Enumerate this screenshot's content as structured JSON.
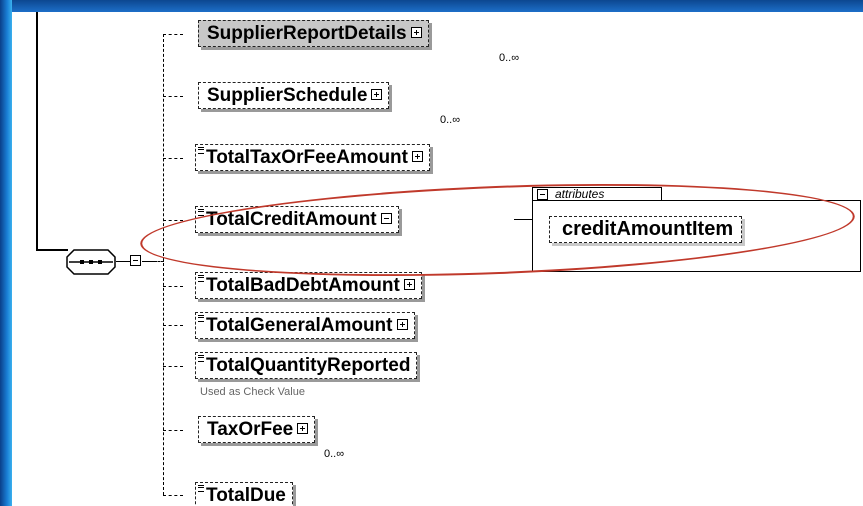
{
  "diagram": {
    "elements": [
      {
        "label": "SupplierReportDetails",
        "cardinality": "0..∞",
        "expander": "plus",
        "highlighted": true
      },
      {
        "label": "SupplierSchedule",
        "cardinality": "0..∞",
        "expander": "plus"
      },
      {
        "label": "TotalTaxOrFeeAmount",
        "expander": "plus"
      },
      {
        "label": "TotalCreditAmount",
        "expander": "minus",
        "circled": true
      },
      {
        "label": "TotalBadDebtAmount",
        "expander": "plus"
      },
      {
        "label": "TotalGeneralAmount",
        "expander": "plus"
      },
      {
        "label": "TotalQuantityReported",
        "note": "Used as Check Value"
      },
      {
        "label": "TaxOrFee",
        "cardinality": "0..∞",
        "expander": "plus"
      },
      {
        "label": "TotalDue"
      }
    ],
    "attributes_group": {
      "title": "attributes",
      "items": [
        "creditAmountItem"
      ]
    },
    "compositor": "sequence",
    "colors": {
      "highlight_fill": "#c7c7c7",
      "circle": "#c0392b",
      "frame": "#0f4f9e"
    }
  }
}
